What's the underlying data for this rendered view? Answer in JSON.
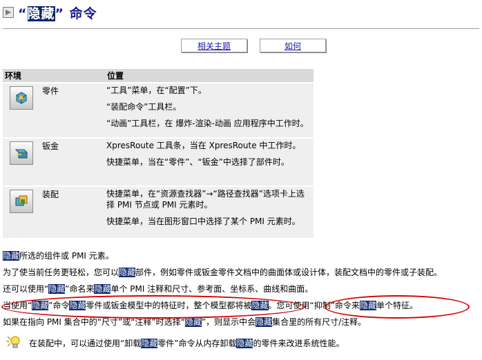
{
  "page": {
    "title_q1": "“",
    "title_hl": "隐藏",
    "title_q2": "”",
    "title_rest": " 命令"
  },
  "buttons": {
    "related": "相关主题",
    "how": "如何"
  },
  "table": {
    "headers": {
      "env": "环境",
      "loc": "位置"
    },
    "rows": [
      {
        "name": "零件",
        "icon": "part-icon",
        "loc": [
          "“工具”菜单，在“配置”下。",
          "“装配命令”工具栏。",
          "“动画”工具栏，在 爆炸-渲染-动画 应用程序中工作时。"
        ]
      },
      {
        "name": "钣金",
        "icon": "sheet-metal-icon",
        "loc": [
          "XpresRoute 工具条，当在 XpresRoute 中工作时。",
          "快捷菜单，当在“零件”、“钣金”中选择了部件时。"
        ]
      },
      {
        "name": "装配",
        "icon": "assembly-icon",
        "loc": [
          "快捷菜单，在“资源查找器”→“路径查找器”选项卡上选择 PMI 节点或 PMI 元素时。",
          "快捷菜单，当在图形窗口中选择了某个 PMI 元素时。"
        ]
      }
    ]
  },
  "body": {
    "l1": {
      "a": "隐藏",
      "b": "所选的组件或 PMI 元素。"
    },
    "l2": {
      "a": "为了使当前任务更轻松，您可以",
      "b": "隐藏",
      "c": "部件，例如零件或钣金零件文档中的曲面体或设计体，装配文档中的零件或子装配。"
    },
    "l3": {
      "a": "还可以使用“",
      "b": "隐藏",
      "c": "”命名来",
      "d": "隐藏",
      "e": "单个 PMI 注释和尺寸、参考面、坐标系、曲线和曲面。"
    },
    "l4": {
      "a": "当使用“",
      "b": "隐藏",
      "c": "”命令",
      "d": "隐藏",
      "e": "零件或钣金模型中的特征时，整个模型都将被",
      "f": "隐藏",
      "g": "。您可使用“抑制”命令来",
      "h": "隐藏",
      "i": "单个特征。"
    },
    "l5": {
      "a": "如果在指向 PMI 集合中的“尺寸”或“注释”时选择“",
      "b": "隐藏",
      "c": "”，则显示中会",
      "d": "隐藏",
      "e": "集合里的所有尺寸/注释。"
    }
  },
  "note": {
    "a": "在装配中，可以通过使用“卸载",
    "b": "隐藏",
    "c": "零件”命令从内存卸载",
    "d": "隐藏",
    "e": "的零件来改进系统性能。"
  },
  "colors": {
    "highlight": "#0a246a",
    "annotation": "#d40000",
    "link": "#1a1aa0"
  }
}
